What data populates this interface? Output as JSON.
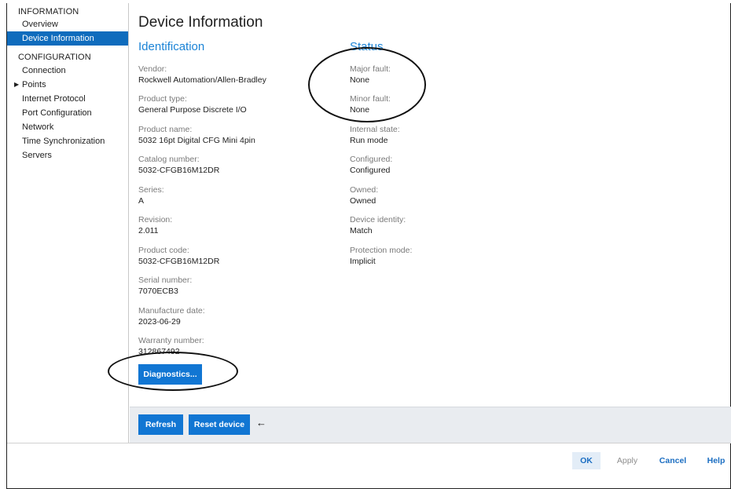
{
  "sidebar": {
    "information_header": "INFORMATION",
    "information_items": [
      {
        "label": "Overview"
      },
      {
        "label": "Device Information"
      }
    ],
    "configuration_header": "CONFIGURATION",
    "configuration_items": [
      {
        "label": "Connection"
      },
      {
        "label": "Points"
      },
      {
        "label": "Internet Protocol"
      },
      {
        "label": "Port Configuration"
      },
      {
        "label": "Network"
      },
      {
        "label": "Time Synchronization"
      },
      {
        "label": "Servers"
      }
    ]
  },
  "main": {
    "title": "Device Information",
    "identification": {
      "heading": "Identification",
      "fields": [
        {
          "label": "Vendor:",
          "value": "Rockwell Automation/Allen-Bradley"
        },
        {
          "label": "Product type:",
          "value": "General Purpose Discrete I/O"
        },
        {
          "label": "Product name:",
          "value": "5032 16pt Digital CFG Mini 4pin"
        },
        {
          "label": "Catalog number:",
          "value": "5032-CFGB16M12DR"
        },
        {
          "label": "Series:",
          "value": "A"
        },
        {
          "label": "Revision:",
          "value": "2.011"
        },
        {
          "label": "Product code:",
          "value": "5032-CFGB16M12DR"
        },
        {
          "label": "Serial number:",
          "value": "7070ECB3"
        },
        {
          "label": "Manufacture date:",
          "value": "2023-06-29"
        },
        {
          "label": "Warranty number:",
          "value": "312867492"
        }
      ]
    },
    "status": {
      "heading": "Status",
      "fields": [
        {
          "label": "Major fault:",
          "value": "None"
        },
        {
          "label": "Minor fault:",
          "value": "None"
        },
        {
          "label": "Internal state:",
          "value": "Run mode"
        },
        {
          "label": "Configured:",
          "value": "Configured"
        },
        {
          "label": "Owned:",
          "value": "Owned"
        },
        {
          "label": "Device identity:",
          "value": "Match"
        },
        {
          "label": "Protection mode:",
          "value": "Implicit"
        }
      ]
    },
    "diagnostics_label": "Diagnostics..."
  },
  "action_bar": {
    "refresh_label": "Refresh",
    "reset_label": "Reset device",
    "arrow_icon": "left-arrow-icon"
  },
  "dialog_buttons": {
    "ok": "OK",
    "apply": "Apply",
    "cancel": "Cancel",
    "help": "Help"
  },
  "colors": {
    "accent": "#1176d3",
    "section_heading": "#1b83d6",
    "selected_nav": "#0f6cbd"
  }
}
